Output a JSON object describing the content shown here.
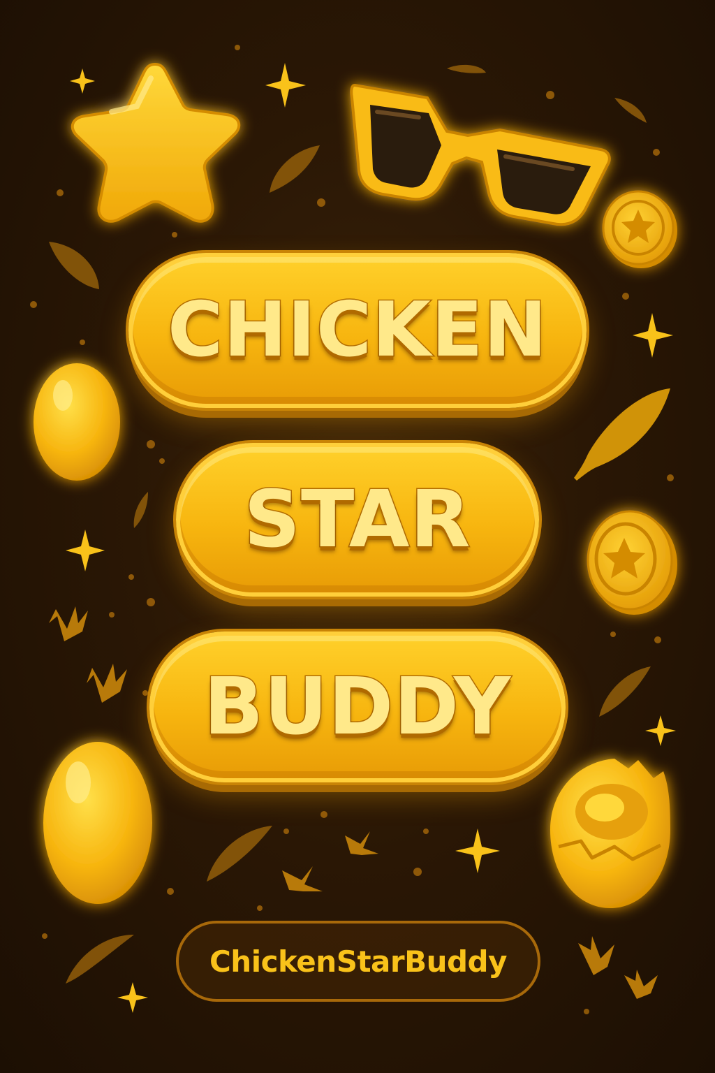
{
  "title_buttons": [
    {
      "label": "CHICKEN"
    },
    {
      "label": "STAR"
    },
    {
      "label": "BUDDY"
    }
  ],
  "brand": {
    "label": "ChickenStarBuddy"
  },
  "colors": {
    "background": "#2a1705",
    "accent": "#f7b50f",
    "accent_light": "#ffe98a",
    "accent_dark": "#b36d00"
  },
  "icons": [
    "star-icon",
    "sunglasses-icon",
    "coin-icon",
    "egg-icon",
    "cracked-egg-icon",
    "feather-icon",
    "sparkle-icon",
    "footprint-icon"
  ]
}
